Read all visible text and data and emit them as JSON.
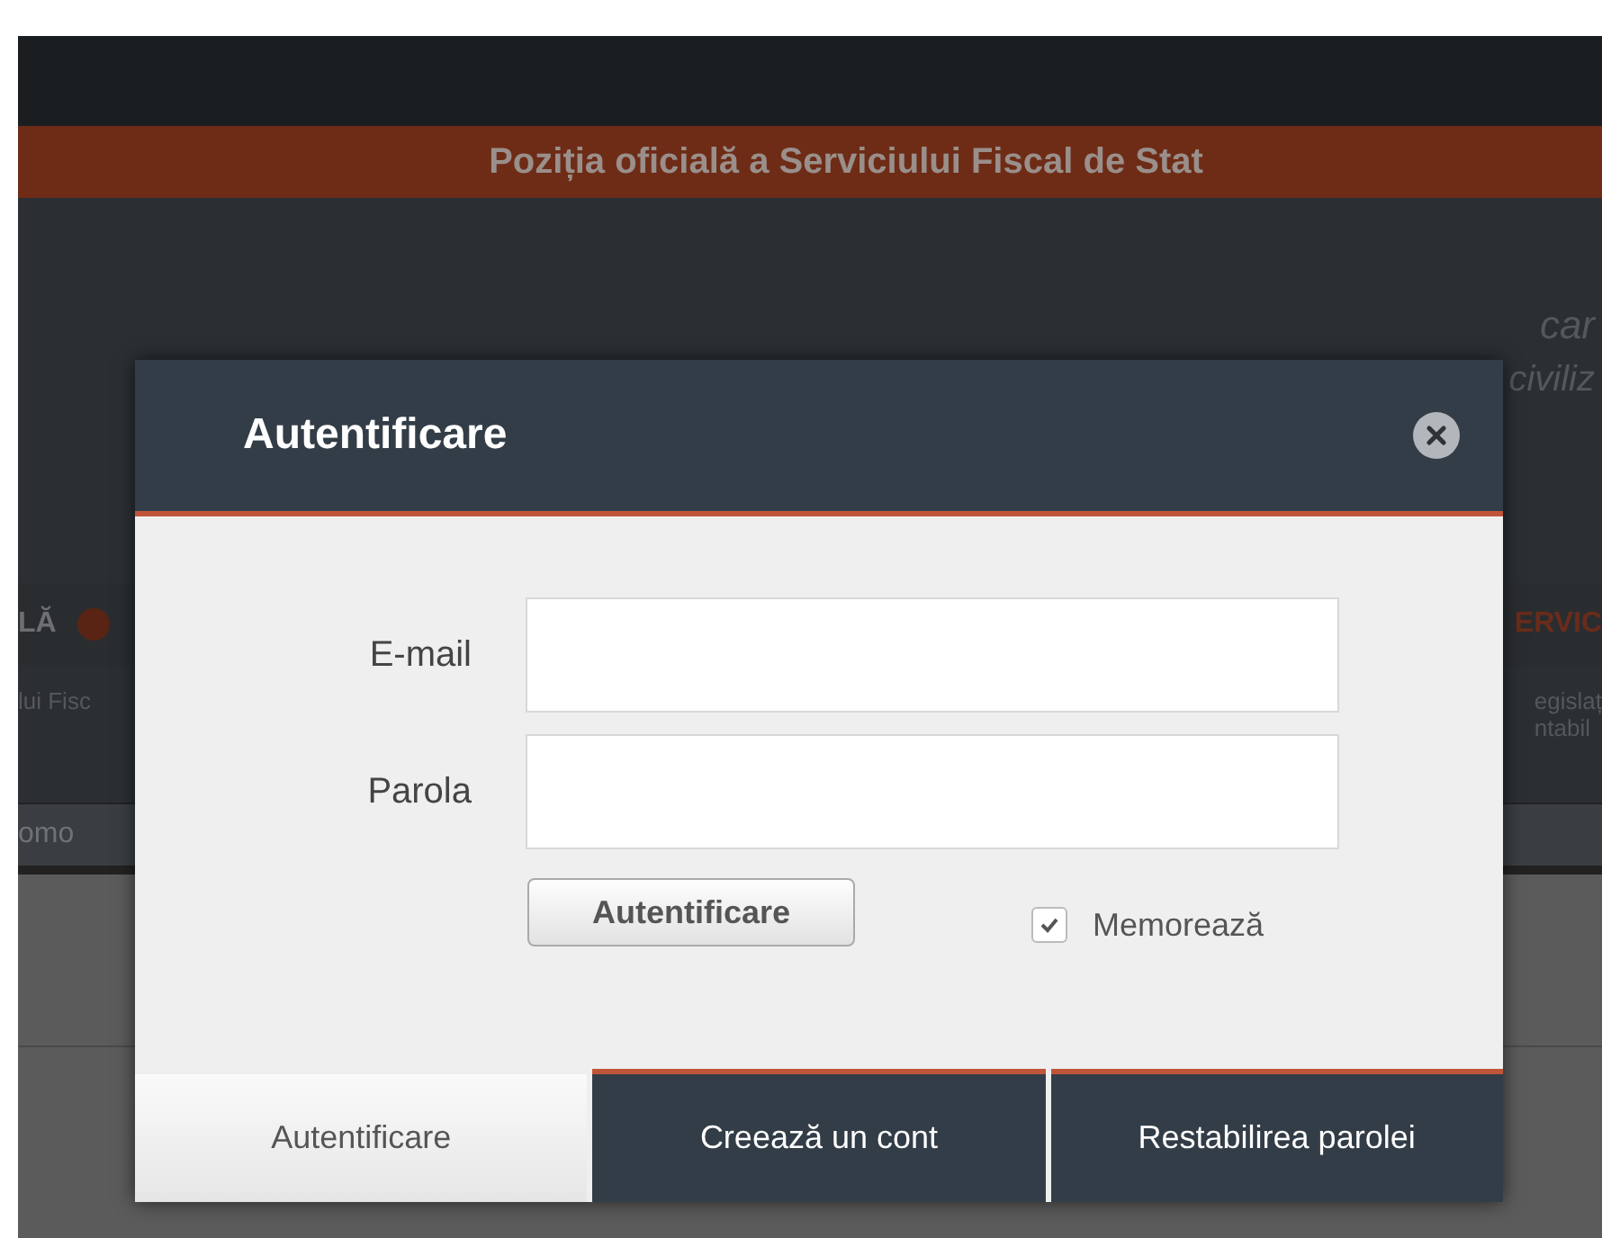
{
  "background": {
    "banner": "Poziția oficială a Serviciului Fiscal de Stat",
    "fragments_right_top": [
      "car",
      "civiliz"
    ],
    "nav_left": "LĂ",
    "nav_right": "ERVIC",
    "sub_left": "lui Fisc",
    "sub_right": [
      "egislaț",
      "ntabil"
    ],
    "bar_left": "omo"
  },
  "dialog": {
    "title": "Autentificare",
    "fields": [
      {
        "label": "E-mail"
      },
      {
        "label": "Parola"
      }
    ],
    "submit": "Autentificare",
    "remember": {
      "label": "Memorează",
      "checked": true
    },
    "tabs": [
      {
        "label": "Autentificare",
        "selected": true
      },
      {
        "label": "Creează un cont",
        "selected": false
      },
      {
        "label": "Restabilirea parolei",
        "selected": false
      }
    ]
  }
}
